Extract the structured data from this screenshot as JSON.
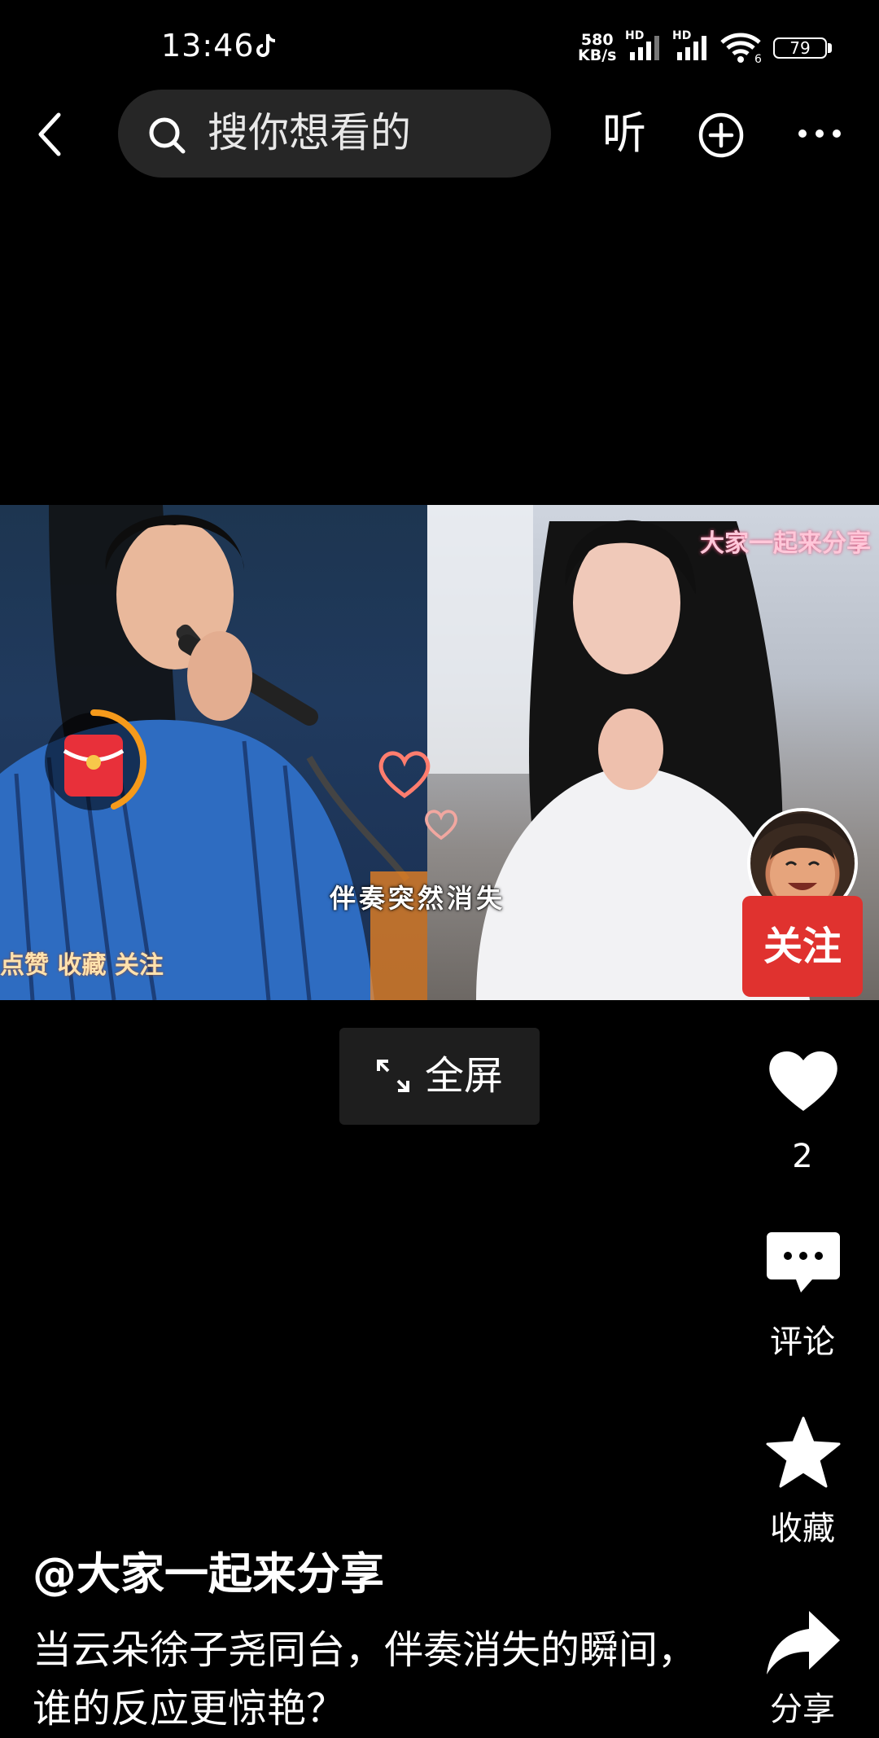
{
  "status_bar": {
    "time": "13:46",
    "net_speed_value": "580",
    "net_speed_unit": "KB/s",
    "hd1": "HD",
    "hd2": "HD",
    "wifi_badge": "6",
    "battery": "79",
    "icons": [
      "tiktok-icon",
      "signal-icon",
      "signal-icon",
      "wifi-icon",
      "battery-icon"
    ]
  },
  "top_bar": {
    "search_placeholder": "搜你想看的",
    "listen_label": "听",
    "icons": [
      "back-icon",
      "search-icon",
      "add-icon",
      "more-icon"
    ]
  },
  "video": {
    "top_right_caption": "大家一起来分享",
    "center_caption": "伴奏突然消失",
    "bottom_left_caption": "点赞 收藏 关注",
    "red_packet_icon": "red-envelope-icon"
  },
  "fullscreen_button": {
    "label": "全屏",
    "icon": "expand-icon"
  },
  "sidebar": {
    "follow_label": "关注",
    "like_count": "2",
    "comment_label": "评论",
    "favorite_label": "收藏",
    "share_label": "分享"
  },
  "post": {
    "author": "@大家一起来分享",
    "description": "当云朵徐子尧同台，伴奏消失的瞬间，谁的反应更惊艳？"
  },
  "colors": {
    "background": "#000000",
    "follow_button": "#e0322f",
    "search_bg": "#262626",
    "red_packet": "#e8303a",
    "timer_ring": "#f59a1b"
  }
}
